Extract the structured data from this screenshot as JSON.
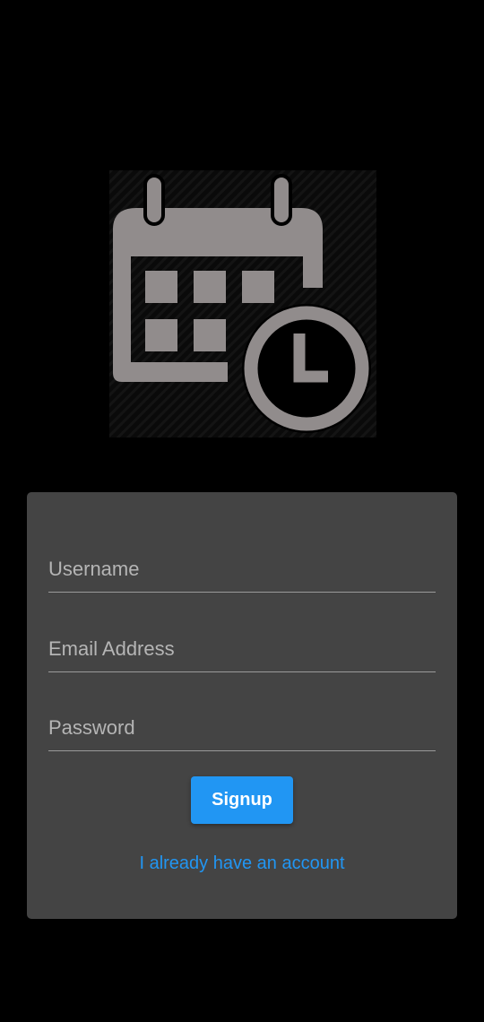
{
  "colors": {
    "background": "#000000",
    "card": "#444444",
    "accent": "#2196f3",
    "icon": "#918c8c"
  },
  "logo": {
    "icon": "calendar-clock-icon"
  },
  "form": {
    "username": {
      "placeholder": "Username",
      "value": ""
    },
    "email": {
      "placeholder": "Email Address",
      "value": ""
    },
    "password": {
      "placeholder": "Password",
      "value": ""
    },
    "signup_label": "Signup",
    "login_link": "I already have an account"
  }
}
